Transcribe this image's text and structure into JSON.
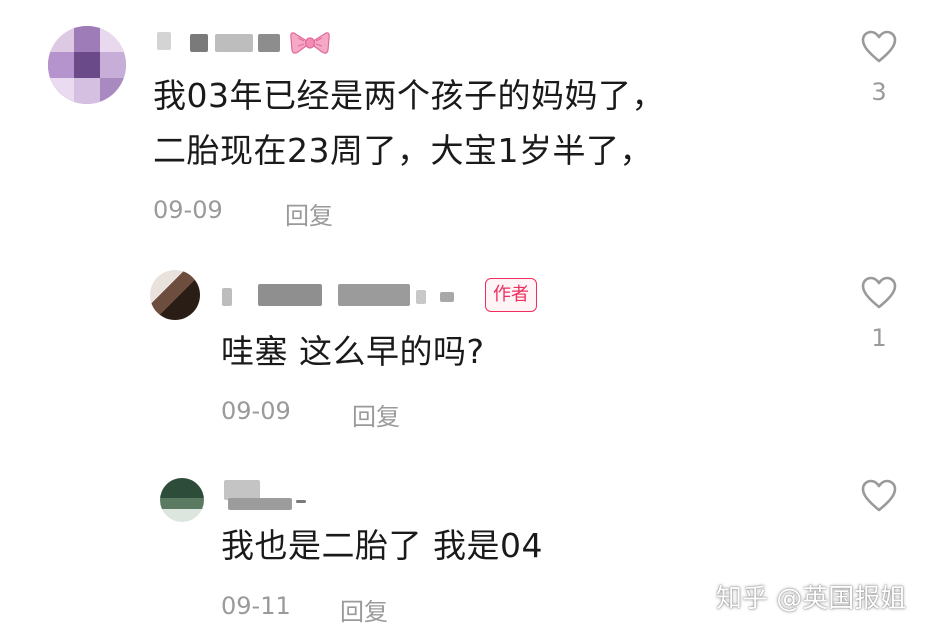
{
  "comments": [
    {
      "text_lines": [
        "我03年已经是两个孩子的妈妈了，",
        "二胎现在23周了，大宝1岁半了，"
      ],
      "date": "09-09",
      "reply_label": "回复",
      "likes": "3"
    },
    {
      "text_lines": [
        "哇塞 这么早的吗?"
      ],
      "badge": "作者",
      "date": "09-09",
      "reply_label": "回复",
      "likes": "1"
    },
    {
      "text_lines": [
        "我也是二胎了 我是04"
      ],
      "date": "09-11",
      "reply_label": "回复",
      "likes": ""
    }
  ],
  "watermark": "知乎 @英国报姐",
  "colors": {
    "text": "#1a1a1a",
    "meta": "#9a9a9a",
    "badge": "#ee2e5e",
    "heart_stroke": "#9a9a9a"
  },
  "icons": [
    "heart-outline-icon",
    "bow-emoji-icon"
  ]
}
